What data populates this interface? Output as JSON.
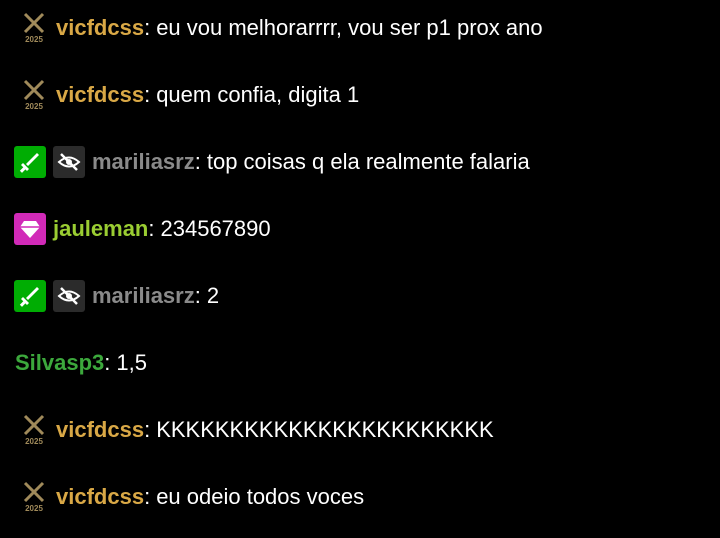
{
  "colors": {
    "vicfdcss": "#d9a846",
    "mariliasrz": "#8a8a8a",
    "jauleman": "#9acd32",
    "silvasp3": "#3ca83c",
    "background": "#000000",
    "text": "#ffffff"
  },
  "badges": {
    "vct_year": "2025"
  },
  "messages": [
    {
      "user": "vicfdcss",
      "colon": ":",
      "text": "eu vou melhorarrrr, vou ser p1 prox ano",
      "badges": [
        "vct-2025-icon"
      ]
    },
    {
      "user": "vicfdcss",
      "colon": ":",
      "text": "quem confia, digita 1",
      "badges": [
        "vct-2025-icon"
      ]
    },
    {
      "user": "mariliasrz",
      "colon": ":",
      "text": "top coisas q ela realmente falaria",
      "badges": [
        "sword-icon",
        "no-audio-icon"
      ]
    },
    {
      "user": "jauleman",
      "colon": ":",
      "text": "234567890",
      "badges": [
        "gem-icon"
      ]
    },
    {
      "user": "mariliasrz",
      "colon": ":",
      "text": "2",
      "badges": [
        "sword-icon",
        "no-audio-icon"
      ]
    },
    {
      "user": "Silvasp3",
      "colon": ":",
      "text": "1,5",
      "badges": []
    },
    {
      "user": "vicfdcss",
      "colon": ":",
      "text": "KKKKKKKKKKKKKKKKKKKKKKK",
      "badges": [
        "vct-2025-icon"
      ]
    },
    {
      "user": "vicfdcss",
      "colon": ":",
      "text": "eu odeio todos voces",
      "badges": [
        "vct-2025-icon"
      ]
    }
  ]
}
